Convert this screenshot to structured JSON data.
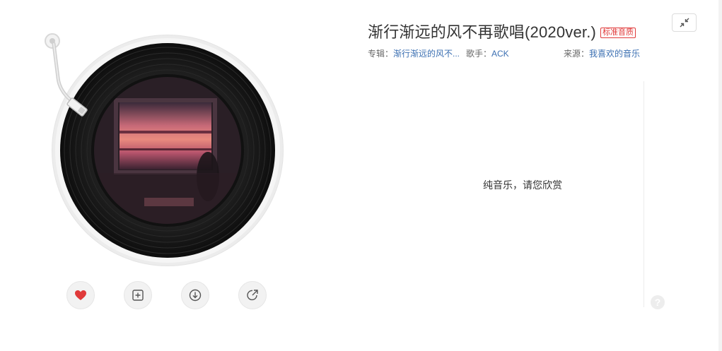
{
  "song": {
    "title": "渐行渐远的风不再歌唱(2020ver.)",
    "quality_badge": "标准音质"
  },
  "meta": {
    "album_label": "专辑：",
    "album_value": "渐行渐远的风不...",
    "artist_label": "歌手：",
    "artist_value": "ACK",
    "source_label": "来源：",
    "source_value": "我喜欢的音乐"
  },
  "lyrics": {
    "message": "纯音乐，请您欣赏"
  },
  "controls": [
    {
      "name": "like-button",
      "icon": "heart-icon",
      "liked": true
    },
    {
      "name": "add-to-playlist-button",
      "icon": "add-square-icon"
    },
    {
      "name": "download-button",
      "icon": "download-icon"
    },
    {
      "name": "share-button",
      "icon": "share-icon"
    }
  ],
  "help": {
    "label": "?"
  },
  "colors": {
    "accent_red": "#e03a3a",
    "link_blue": "#3b6fb2"
  }
}
